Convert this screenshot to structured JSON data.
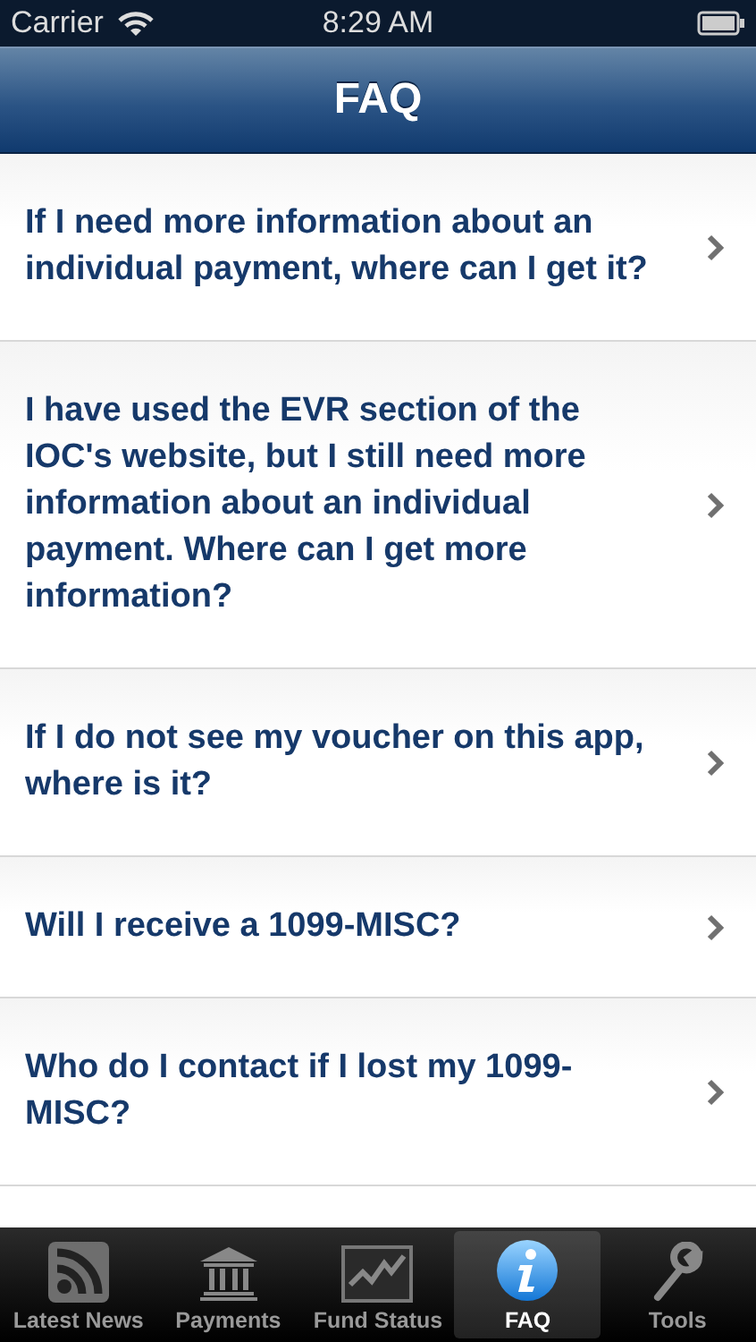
{
  "status_bar": {
    "carrier": "Carrier",
    "time": "8:29 AM"
  },
  "nav_bar": {
    "title": "FAQ"
  },
  "faq_items": [
    {
      "question": "If I need more information about an individual payment, where can I get it?"
    },
    {
      "question": "I have used the EVR section of the IOC's website, but I still need more information about an individual payment. Where can I get more information?"
    },
    {
      "question": "If I do not see my voucher on this app, where is it?"
    },
    {
      "question": "Will I receive a 1099-MISC?"
    },
    {
      "question": "Who do I contact if I lost my 1099-MISC?"
    }
  ],
  "tab_bar": [
    {
      "label": "Latest News",
      "kind": "rss",
      "selected": false
    },
    {
      "label": "Payments",
      "kind": "bank",
      "selected": false
    },
    {
      "label": "Fund Status",
      "kind": "chart",
      "selected": false
    },
    {
      "label": "FAQ",
      "kind": "info",
      "selected": true
    },
    {
      "label": "Tools",
      "kind": "wrench",
      "selected": false
    }
  ]
}
